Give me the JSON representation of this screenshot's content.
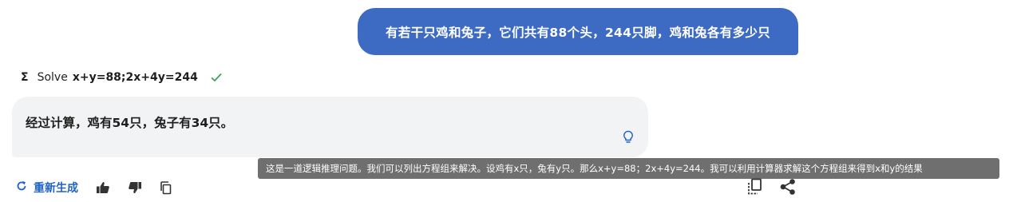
{
  "user_message": "有若干只鸡和兔子，它们共有88个头，244只脚，鸡和兔各有多少只",
  "tool_call": {
    "icon": "sigma-icon",
    "label": "Solve",
    "expression": "x+y=88;2x+4y=244",
    "status_icon": "check-icon",
    "status_color": "#3aa657"
  },
  "answer": {
    "text": "经过计算，鸡有54只，兔子有34只。",
    "icon": "lightbulb-icon"
  },
  "tooltip": {
    "text": "这是一道逻辑推理问题。我们可以列出方程组来解决。设鸡有x只，兔有y只。那么x+y=88；2x+4y=244。我可以利用计算器求解这个方程组来得到x和y的结果"
  },
  "actions": {
    "regenerate_label": "重新生成",
    "icons": [
      "refresh-icon",
      "thumbs-up-icon",
      "thumbs-down-icon",
      "copy-icon",
      "copy-all-icon",
      "share-icon"
    ]
  },
  "colors": {
    "user_bubble": "#3d6ac2",
    "answer_card": "#f2f3f5",
    "accent": "#1f63c6",
    "tooltip_bg": "#6f6f6f"
  }
}
